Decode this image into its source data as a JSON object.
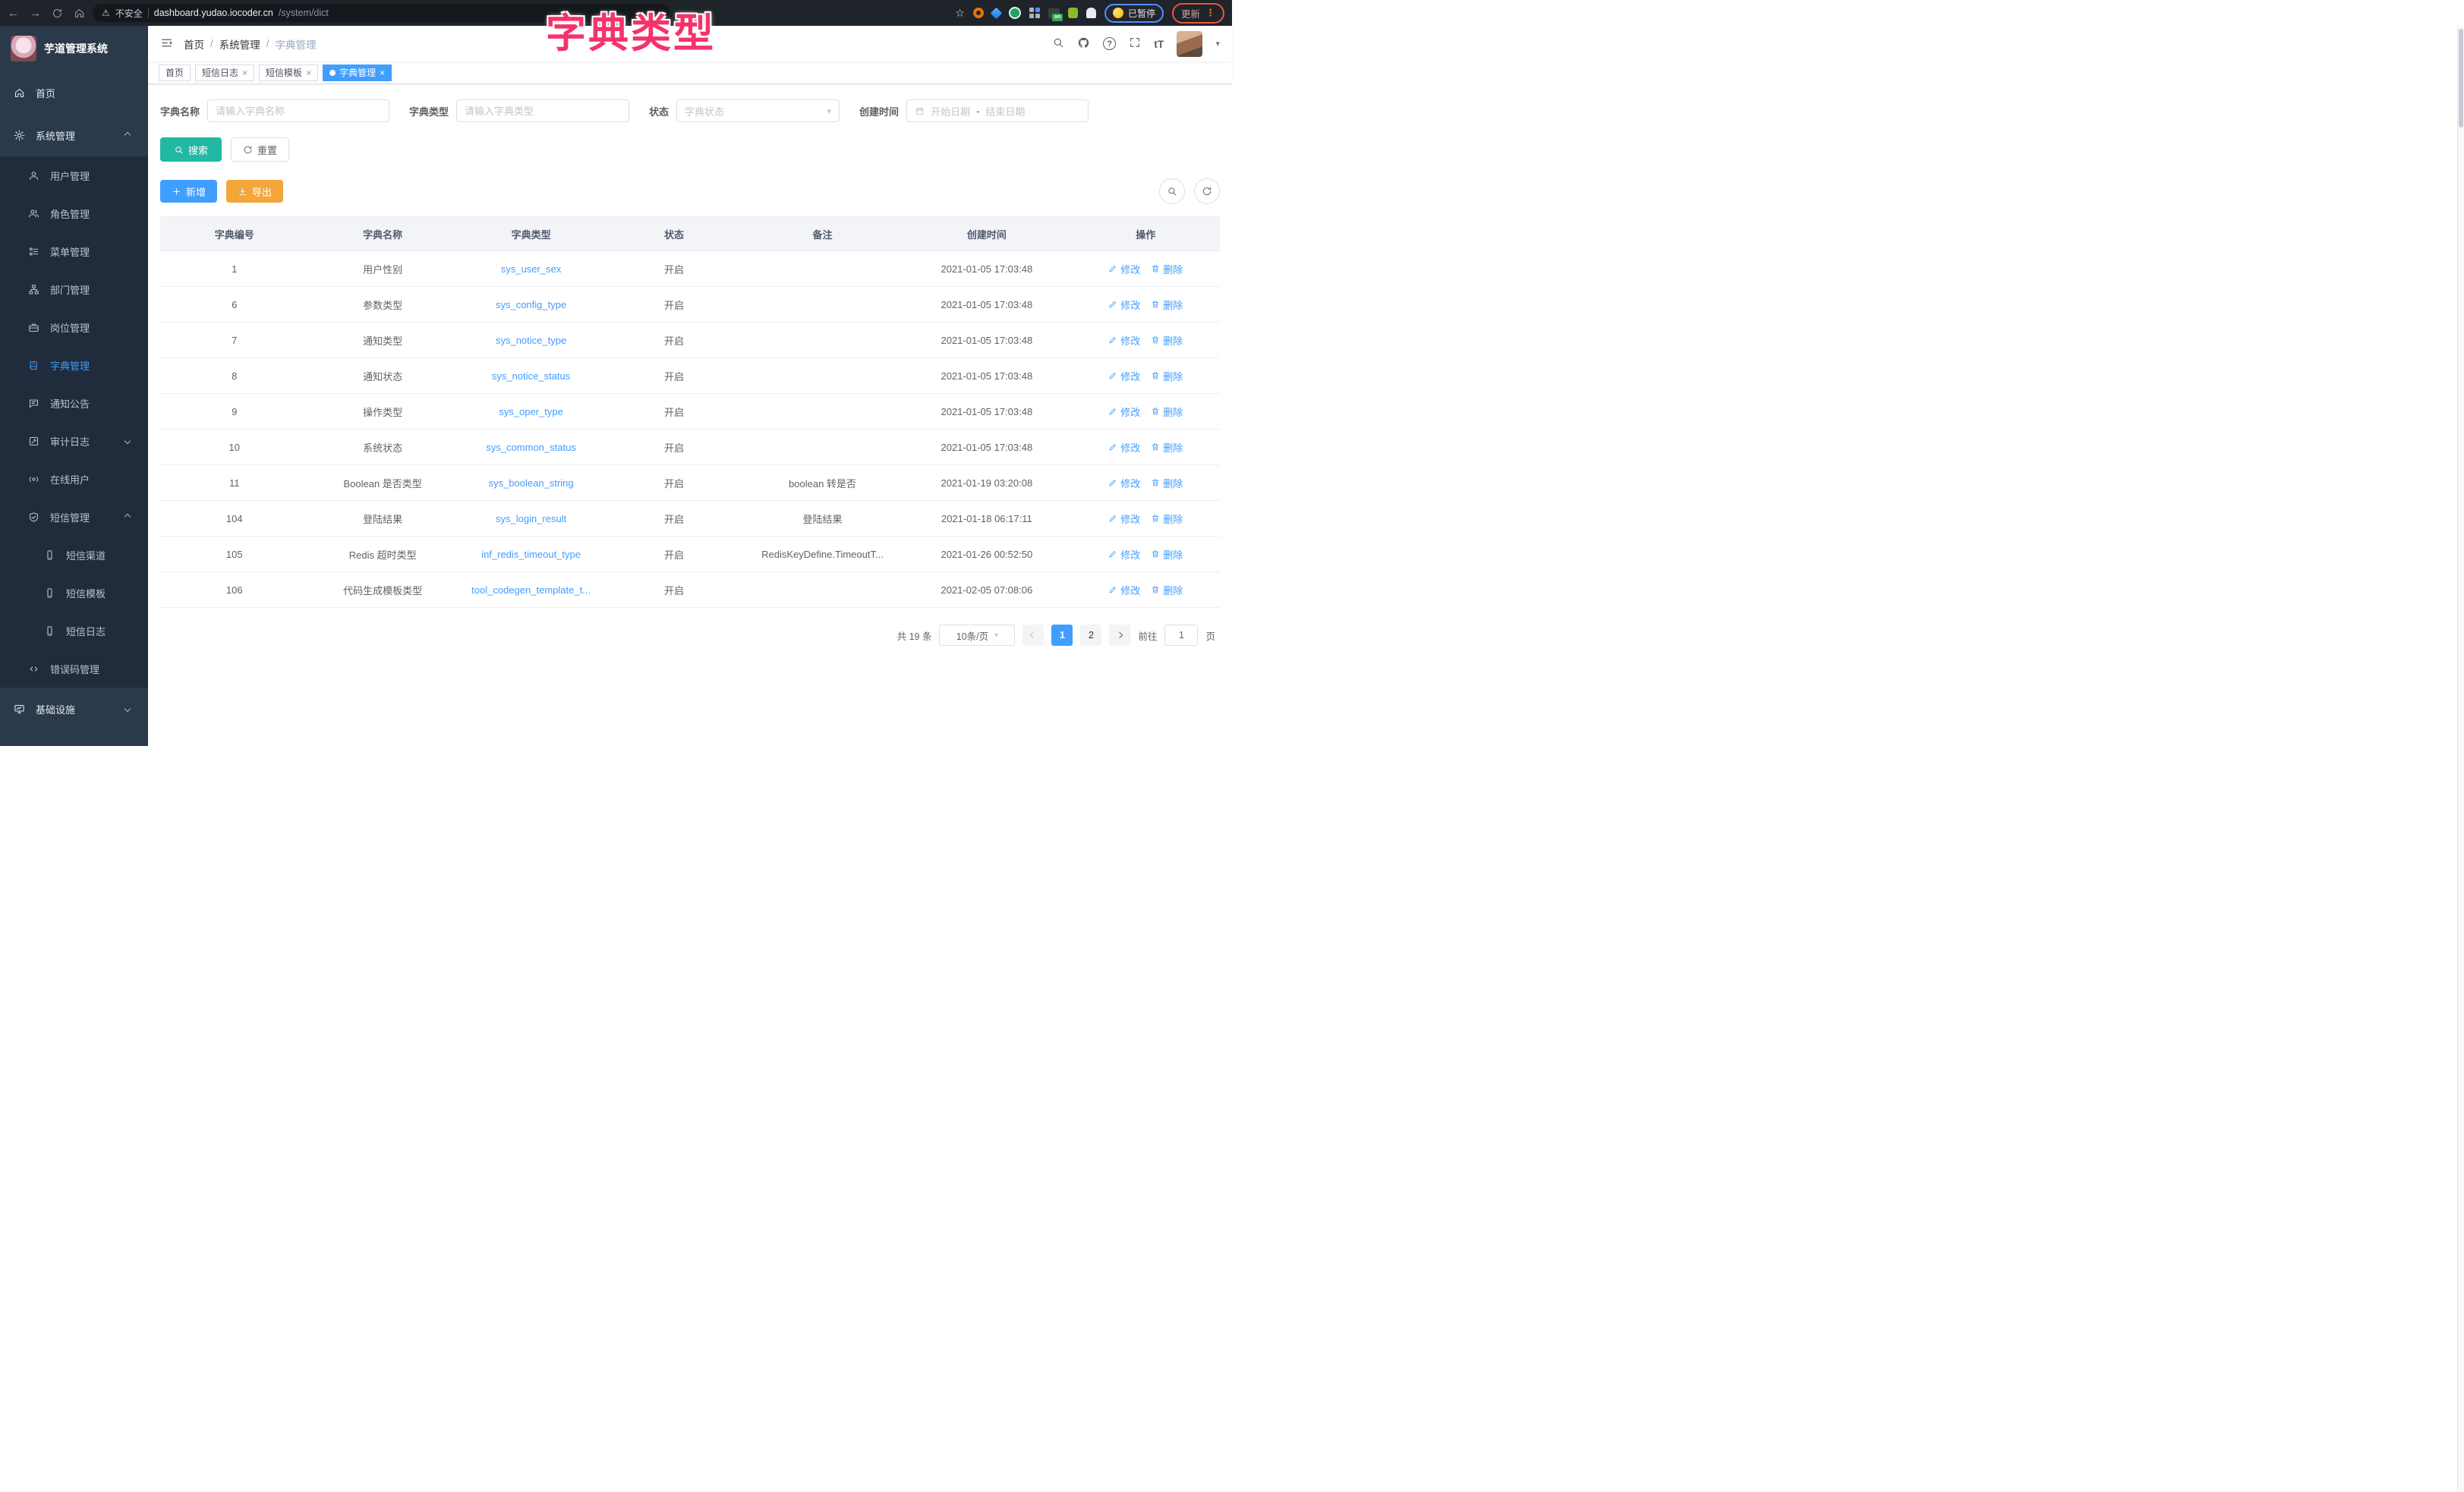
{
  "overlay": {
    "text": "字典类型"
  },
  "browser": {
    "security_label": "不安全",
    "url_host": "dashboard.yudao.iocoder.cn",
    "url_path": "/system/dict",
    "on_badge": "on",
    "paused_label": "已暂停",
    "update_label": "更新"
  },
  "icons": {
    "close": "×",
    "caret": "▾",
    "back": "←",
    "forward": "→",
    "star": "☆",
    "warning": "⚠",
    "more": "⋮",
    "question": "?",
    "fontsize": "tT",
    "range_sep": "-"
  },
  "sidebar": {
    "logo_title": "芋道管理系统",
    "items": [
      {
        "label": "首页"
      },
      {
        "label": "系统管理"
      },
      {
        "label": "用户管理"
      },
      {
        "label": "角色管理"
      },
      {
        "label": "菜单管理"
      },
      {
        "label": "部门管理"
      },
      {
        "label": "岗位管理"
      },
      {
        "label": "字典管理"
      },
      {
        "label": "通知公告"
      },
      {
        "label": "审计日志"
      },
      {
        "label": "在线用户"
      },
      {
        "label": "短信管理"
      },
      {
        "label": "短信渠道"
      },
      {
        "label": "短信模板"
      },
      {
        "label": "短信日志"
      },
      {
        "label": "错误码管理"
      },
      {
        "label": "基础设施"
      }
    ]
  },
  "breadcrumb": {
    "items": [
      "首页",
      "系统管理",
      "字典管理"
    ],
    "separator": "/"
  },
  "tabs": [
    {
      "label": "首页"
    },
    {
      "label": "短信日志"
    },
    {
      "label": "短信模板"
    },
    {
      "label": "字典管理"
    }
  ],
  "search": {
    "name_label": "字典名称",
    "name_placeholder": "请输入字典名称",
    "type_label": "字典类型",
    "type_placeholder": "请输入字典类型",
    "status_label": "状态",
    "status_placeholder": "字典状态",
    "date_label": "创建时间",
    "date_start": "开始日期",
    "date_end": "结束日期",
    "search_btn": "搜索",
    "reset_btn": "重置"
  },
  "toolbar": {
    "add_btn": "新增",
    "export_btn": "导出"
  },
  "table": {
    "columns": [
      "字典编号",
      "字典名称",
      "字典类型",
      "状态",
      "备注",
      "创建时间",
      "操作"
    ],
    "op_edit": "修改",
    "op_delete": "删除",
    "rows": [
      {
        "id": "1",
        "name": "用户性别",
        "type": "sys_user_sex",
        "status": "开启",
        "remark": "",
        "created": "2021-01-05 17:03:48"
      },
      {
        "id": "6",
        "name": "参数类型",
        "type": "sys_config_type",
        "status": "开启",
        "remark": "",
        "created": "2021-01-05 17:03:48"
      },
      {
        "id": "7",
        "name": "通知类型",
        "type": "sys_notice_type",
        "status": "开启",
        "remark": "",
        "created": "2021-01-05 17:03:48"
      },
      {
        "id": "8",
        "name": "通知状态",
        "type": "sys_notice_status",
        "status": "开启",
        "remark": "",
        "created": "2021-01-05 17:03:48"
      },
      {
        "id": "9",
        "name": "操作类型",
        "type": "sys_oper_type",
        "status": "开启",
        "remark": "",
        "created": "2021-01-05 17:03:48"
      },
      {
        "id": "10",
        "name": "系统状态",
        "type": "sys_common_status",
        "status": "开启",
        "remark": "",
        "created": "2021-01-05 17:03:48"
      },
      {
        "id": "11",
        "name": "Boolean 是否类型",
        "type": "sys_boolean_string",
        "status": "开启",
        "remark": "boolean 转是否",
        "created": "2021-01-19 03:20:08"
      },
      {
        "id": "104",
        "name": "登陆结果",
        "type": "sys_login_result",
        "status": "开启",
        "remark": "登陆结果",
        "created": "2021-01-18 06:17:11"
      },
      {
        "id": "105",
        "name": "Redis 超时类型",
        "type": "inf_redis_timeout_type",
        "status": "开启",
        "remark": "RedisKeyDefine.TimeoutT...",
        "created": "2021-01-26 00:52:50"
      },
      {
        "id": "106",
        "name": "代码生成模板类型",
        "type": "tool_codegen_template_t...",
        "status": "开启",
        "remark": "",
        "created": "2021-02-05 07:08:06"
      }
    ]
  },
  "pagination": {
    "total": "共 19 条",
    "page_size": "10条/页",
    "page1": "1",
    "page2": "2",
    "goto_label": "前往",
    "goto_value": "1",
    "page_suffix": "页"
  },
  "colors": {
    "accent": "#409eff",
    "search_teal": "#23b8a2",
    "export_amber": "#f3a73a",
    "overlay_pink": "#f5336b",
    "sidebar_bg": "#2b3a4b",
    "submenu_bg": "#202c3c"
  }
}
